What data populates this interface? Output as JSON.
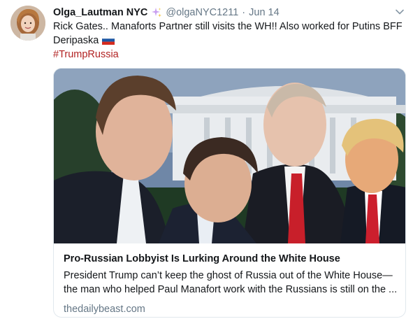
{
  "tweet": {
    "display_name": "Olga_Lautman NYC",
    "name_emoji_icon": "sparkles-icon",
    "handle": "@olgaNYC1211",
    "separator": "·",
    "timestamp": "Jun 14",
    "menu_icon": "chevron-down-icon",
    "text_line1": "Rick Gates.. Manaforts Partner still visits the WH!! Also worked for Putins BFF",
    "text_line2": "Deripaska",
    "flag_icon": "russia-flag-icon",
    "hashtag": "#TrumpRussia",
    "colors": {
      "hashtag": "#b22222",
      "secondary_text": "#657786",
      "card_border": "#e1e8ed"
    }
  },
  "card": {
    "image_icon": "article-photo",
    "title": "Pro-Russian Lobbyist Is Lurking Around the White House",
    "description_line1": "President Trump can’t keep the ghost of Russia out of the White House—",
    "description_line2": "the man who helped Paul Manafort work with the Russians is still on the ...",
    "domain": "thedailybeast.com"
  }
}
